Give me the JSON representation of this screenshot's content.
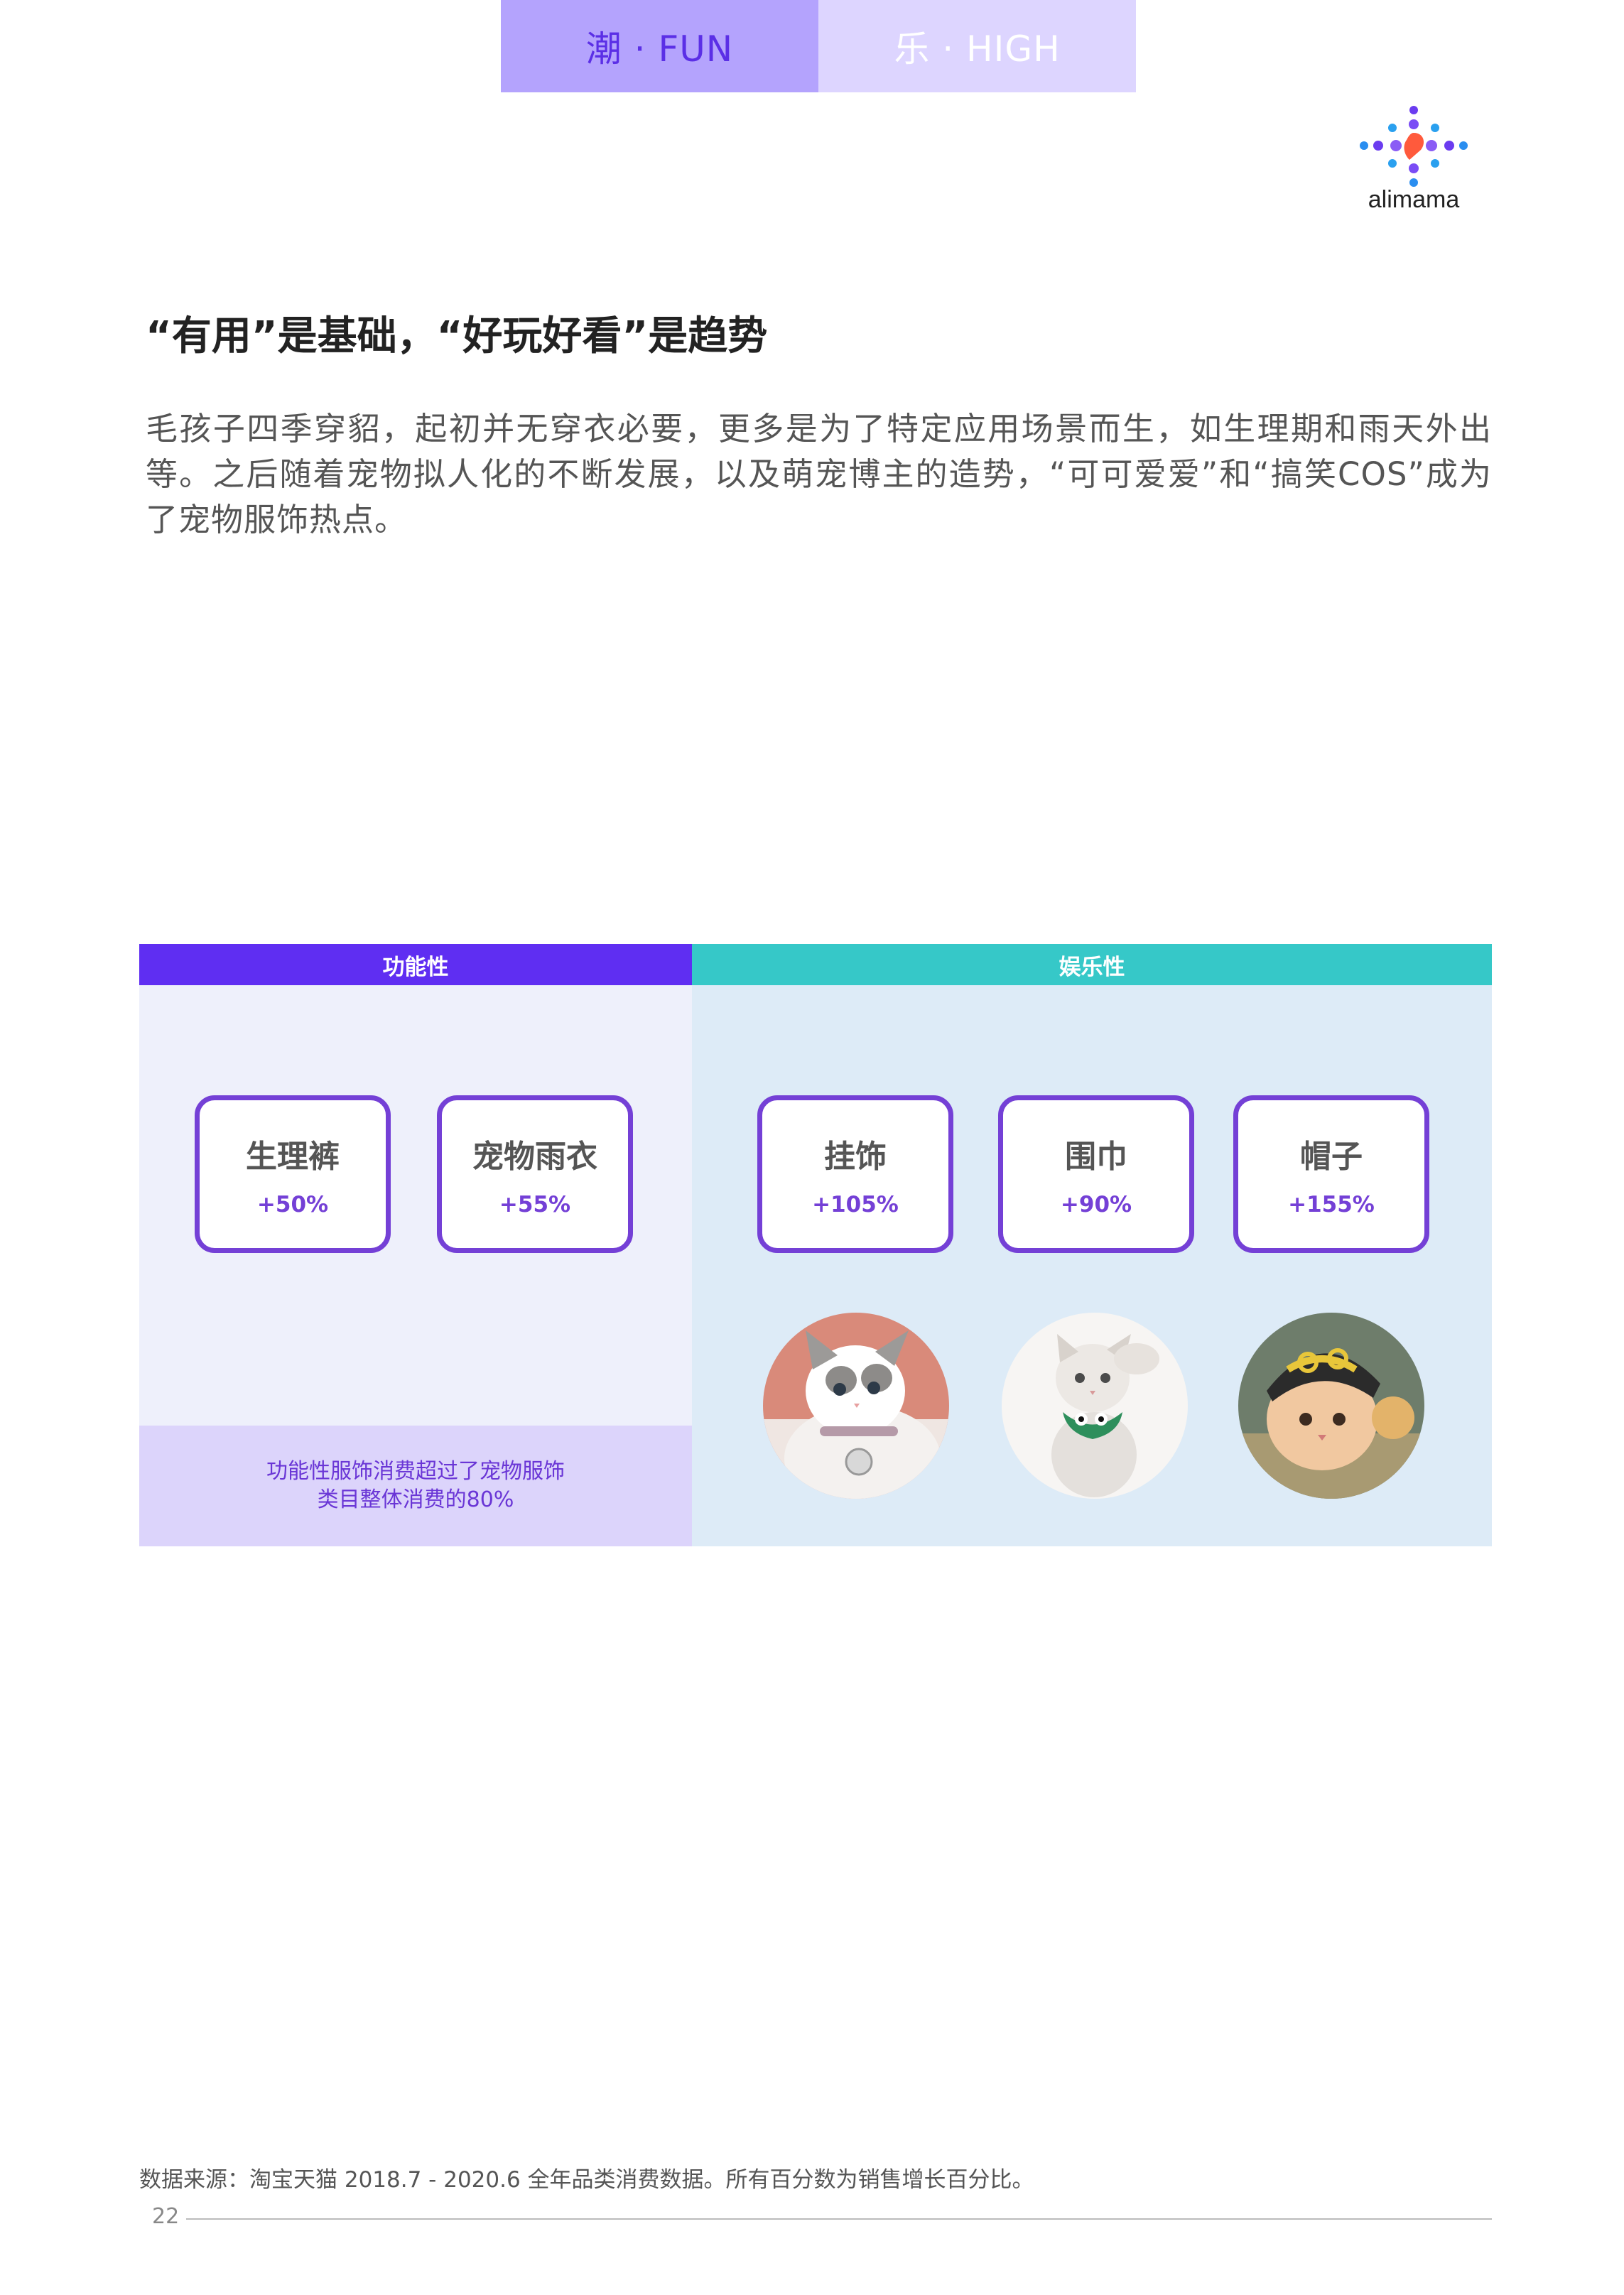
{
  "tabs": [
    {
      "label": "潮 · FUN"
    },
    {
      "label": "乐 · HIGH"
    }
  ],
  "logo": {
    "text": "alimama",
    "icon": "alimama-logo-icon"
  },
  "heading": "“有用”是基础，“好玩好看”是趋势",
  "paragraph": "毛孩子四季穿貂，起初并无穿衣必要，更多是为了特定应用场景而生，如生理期和雨天外出等。之后随着宠物拟人化的不断发展，以及萌宠博主的造势，“可可爱爱”和“搞笑COS”成为了宠物服饰热点。",
  "infographic": {
    "functional": {
      "header": "功能性",
      "items": [
        {
          "name": "生理裤",
          "value": "+50%"
        },
        {
          "name": "宠物雨衣",
          "value": "+55%"
        }
      ],
      "note_line1": "功能性服饰消费超过了宠物服饰",
      "note_line2": "类目整体消费的80%"
    },
    "entertainment": {
      "header": "娱乐性",
      "items": [
        {
          "name": "挂饰",
          "value": "+105%"
        },
        {
          "name": "围巾",
          "value": "+90%"
        },
        {
          "name": "帽子",
          "value": "+155%"
        }
      ]
    }
  },
  "colors": {
    "functional": "#5f2ef2",
    "entertainment": "#36c8c8",
    "card_border": "#7440d6"
  },
  "footer": {
    "source": "数据来源：淘宝天猫 2018.7 - 2020.6 全年品类消费数据。所有百分数为销售增长百分比。",
    "page_number": "22"
  }
}
